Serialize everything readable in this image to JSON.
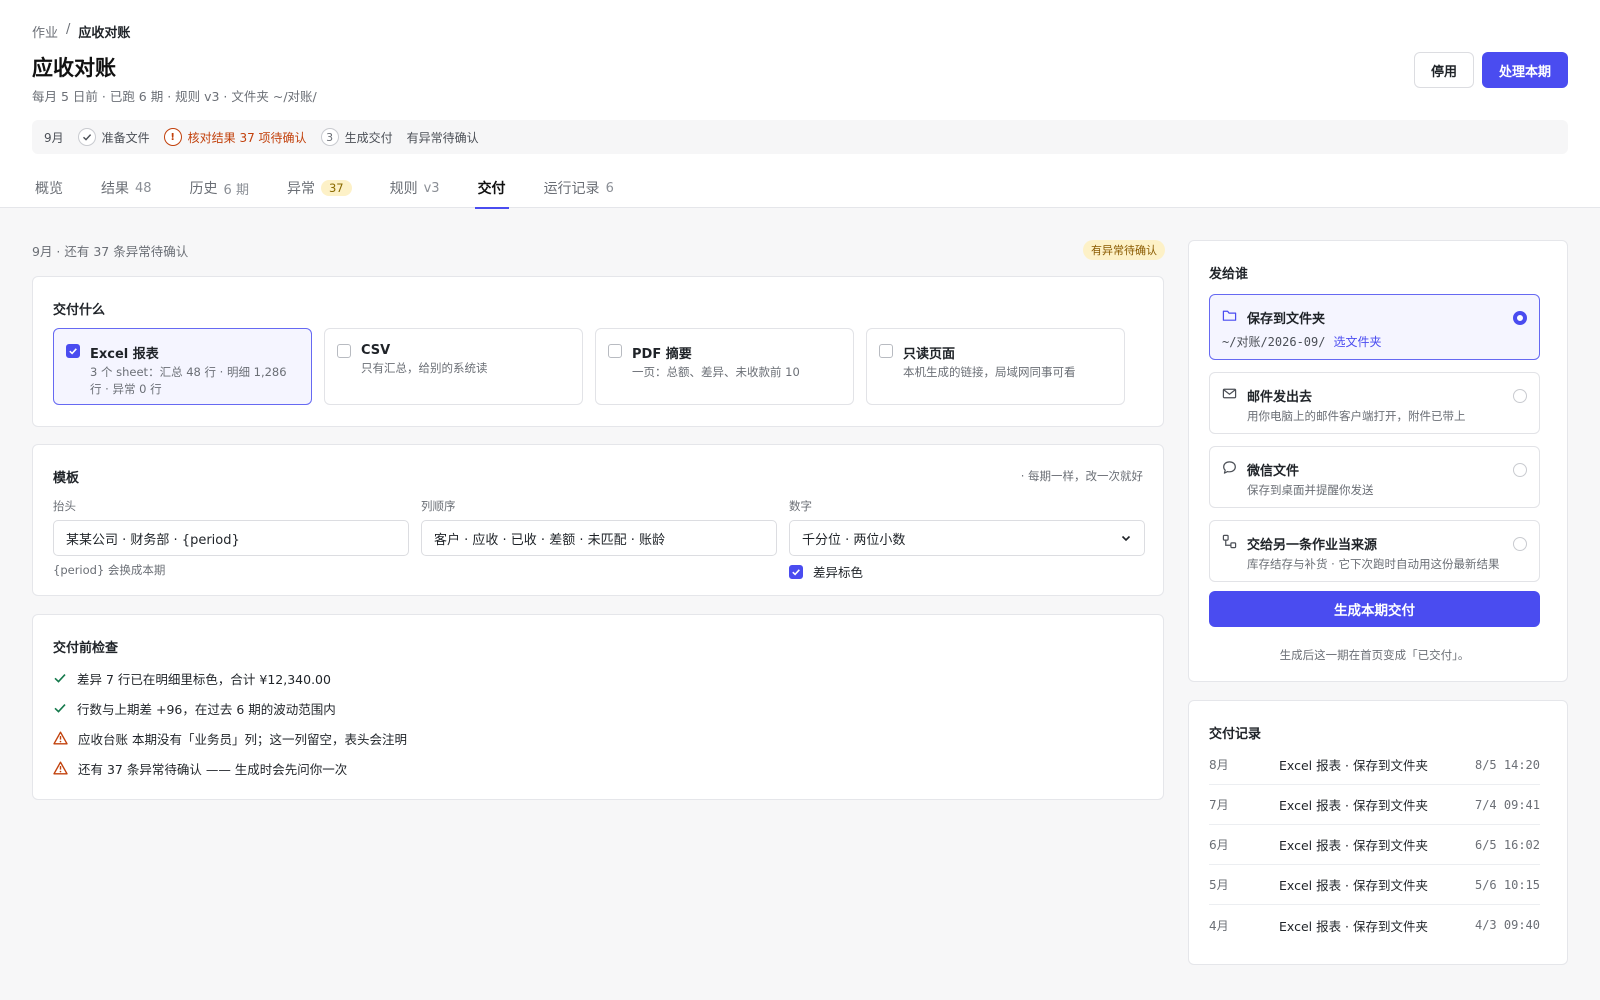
{
  "breadcrumb": {
    "parent": "作业",
    "sep": "/",
    "current": "应收对账"
  },
  "header": {
    "title": "应收对账",
    "subtitle": "每月 5 日前 · 已跑 6 期 · 规则 v3 · 文件夹 ~/对账/",
    "stop_label": "停用",
    "run_label": "处理本期"
  },
  "steps": {
    "month": "9月",
    "s1": "准备文件",
    "s2": "核对结果 37 项待确认",
    "s3_num": "3",
    "s3": "生成交付",
    "s4": "有异常待确认"
  },
  "tabs": [
    {
      "label": "概览",
      "count": ""
    },
    {
      "label": "结果",
      "count": "48"
    },
    {
      "label": "历史",
      "count": "6 期"
    },
    {
      "label": "异常",
      "count": "37"
    },
    {
      "label": "规则",
      "count": "v3"
    },
    {
      "label": "交付",
      "count": ""
    },
    {
      "label": "运行记录",
      "count": "6"
    }
  ],
  "notice": "9月 · 还有 37 条异常待确认",
  "notice_badge": "有异常待确认",
  "deliver_what": {
    "title": "交付什么",
    "options": [
      {
        "title": "Excel 报表",
        "desc": "3 个 sheet：汇总 48 行 · 明细 1,286 行 · 异常 0 行"
      },
      {
        "title": "CSV",
        "desc": "只有汇总，给别的系统读"
      },
      {
        "title": "PDF 摘要",
        "desc": "一页：总额、差异、未收款前 10"
      },
      {
        "title": "只读页面",
        "desc": "本机生成的链接，局域网同事可看"
      }
    ]
  },
  "template": {
    "title": "模板",
    "note": "· 每期一样，改一次就好",
    "header_label": "抬头",
    "header_value": "某某公司 · 财务部 · {period}",
    "header_hint": "{period} 会换成本期",
    "order_label": "列顺序",
    "order_value": "客户 · 应收 · 已收 · 差额 · 未匹配 · 账龄",
    "number_label": "数字",
    "number_value": "千分位 · 两位小数",
    "diff_color_label": "差异标色"
  },
  "precheck": {
    "title": "交付前检查",
    "items": [
      "差异 7 行已在明细里标色，合计 ¥12,340.00",
      "行数与上期差 +96，在过去 6 期的波动范围内",
      "应收台账 本期没有「业务员」列；这一列留空，表头会注明",
      "还有 37 条异常待确认 —— 生成时会先问你一次"
    ]
  },
  "send_to": {
    "title": "发给谁",
    "options": [
      {
        "title": "保存到文件夹",
        "path": "~/对账/2026-09/",
        "link": "选文件夹"
      },
      {
        "title": "邮件发出去",
        "desc": "用你电脑上的邮件客户端打开，附件已带上"
      },
      {
        "title": "微信文件",
        "desc": "保存到桌面并提醒你发送"
      },
      {
        "title": "交给另一条作业当来源",
        "desc": "库存结存与补货 · 它下次跑时自动用这份最新结果"
      }
    ],
    "generate_label": "生成本期交付",
    "generate_hint": "生成后这一期在首页变成「已交付」。"
  },
  "records": {
    "title": "交付记录",
    "rows": [
      {
        "month": "8月",
        "desc": "Excel 报表 · 保存到文件夹",
        "time": "8/5 14:20"
      },
      {
        "month": "7月",
        "desc": "Excel 报表 · 保存到文件夹",
        "time": "7/4 09:41"
      },
      {
        "month": "6月",
        "desc": "Excel 报表 · 保存到文件夹",
        "time": "6/5 16:02"
      },
      {
        "month": "5月",
        "desc": "Excel 报表 · 保存到文件夹",
        "time": "5/6 10:15"
      },
      {
        "month": "4月",
        "desc": "Excel 报表 · 保存到文件夹",
        "time": "4/3 09:40"
      }
    ]
  },
  "colors": {
    "accent": "#4a4cf0",
    "warn": "#c2410c",
    "ok": "#16794c"
  }
}
